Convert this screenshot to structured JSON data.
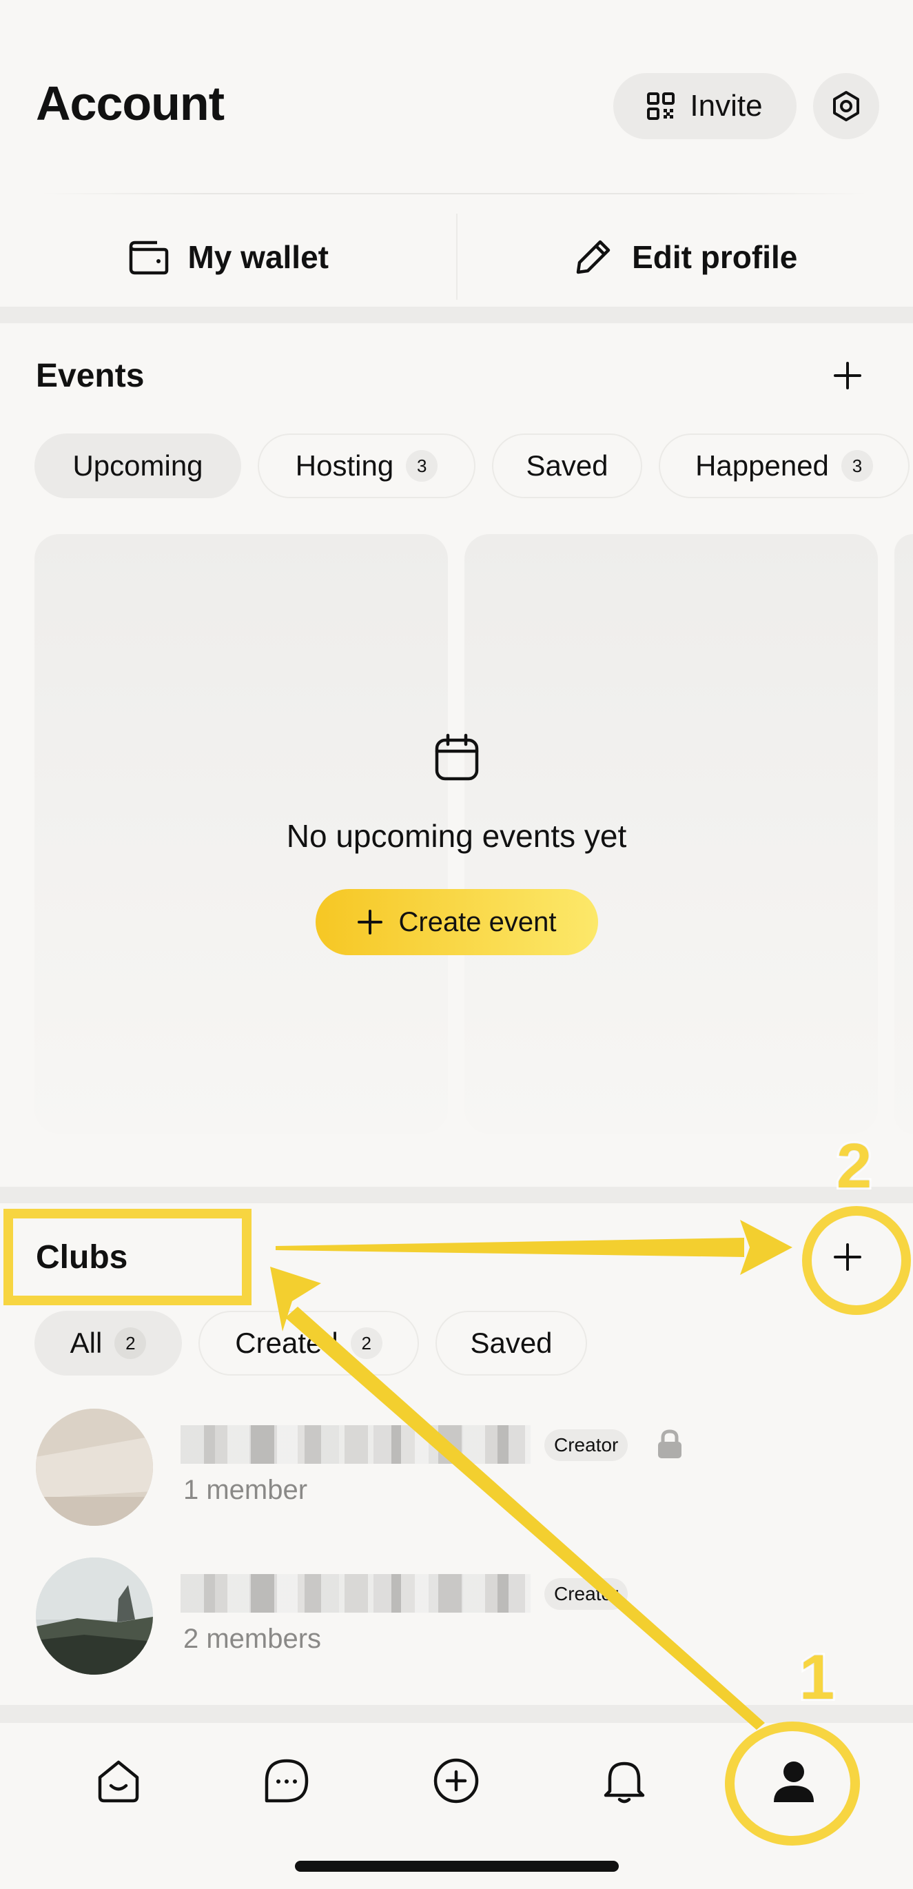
{
  "header": {
    "title": "Account",
    "invite_label": "Invite"
  },
  "quick_actions": {
    "wallet_label": "My wallet",
    "edit_profile_label": "Edit profile"
  },
  "events": {
    "title": "Events",
    "tabs": [
      {
        "label": "Upcoming",
        "count": null,
        "active": true
      },
      {
        "label": "Hosting",
        "count": "3",
        "active": false
      },
      {
        "label": "Saved",
        "count": null,
        "active": false
      },
      {
        "label": "Happened",
        "count": "3",
        "active": false
      }
    ],
    "empty_text": "No upcoming events yet",
    "create_label": "Create event"
  },
  "clubs": {
    "title": "Clubs",
    "tabs": [
      {
        "label": "All",
        "count": "2",
        "active": true
      },
      {
        "label": "Created",
        "count": "2",
        "active": false
      },
      {
        "label": "Saved",
        "count": null,
        "active": false
      }
    ],
    "items": [
      {
        "badge": "Creator",
        "members": "1 member",
        "locked": true
      },
      {
        "badge": "Creator",
        "members": "2 members",
        "locked": false
      }
    ]
  },
  "annotations": {
    "step1": "1",
    "step2": "2"
  },
  "icons": {
    "invite": "qr-code-icon",
    "settings": "gear-icon",
    "wallet": "wallet-icon",
    "edit": "pencil-icon",
    "lock": "lock-icon",
    "tabs": [
      "home-icon",
      "chat-icon",
      "plus-circle-icon",
      "bell-icon",
      "person-icon"
    ]
  },
  "colors": {
    "accent_yellow": "#f7d541",
    "create_button_start": "#f6c724",
    "create_button_end": "#fce86a",
    "background": "#f8f7f5",
    "chip_active": "#ebeae8"
  }
}
